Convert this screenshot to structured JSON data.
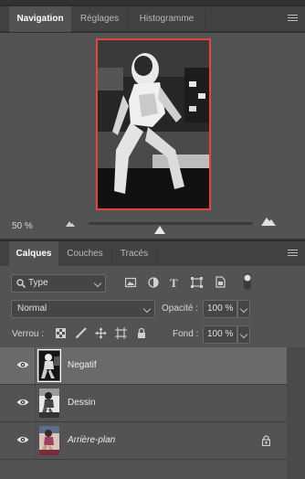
{
  "top_panel": {
    "tabs": [
      {
        "label": "Navigation",
        "active": true
      },
      {
        "label": "Réglages",
        "active": false
      },
      {
        "label": "Histogramme",
        "active": false
      }
    ],
    "menu_icon": "hamburger-menu-icon"
  },
  "navigator": {
    "zoom": "50 %",
    "zoom_slider_value_percent": 50,
    "view_rect_color": "#e34444"
  },
  "layers_panel": {
    "tabs": [
      {
        "label": "Calques",
        "active": true
      },
      {
        "label": "Couches",
        "active": false
      },
      {
        "label": "Tracés",
        "active": false
      }
    ],
    "filter": {
      "type_label": "Type",
      "icons": [
        "image-filter-icon",
        "adjustment-filter-icon",
        "type-filter-icon",
        "shape-filter-icon",
        "smart-object-filter-icon",
        "filter-toggle-icon"
      ]
    },
    "blend_mode": "Normal",
    "opacity_label": "Opacité :",
    "opacity_value": "100 %",
    "lock_label": "Verrou :",
    "lock_icons": [
      "lock-transparency-icon",
      "lock-image-icon",
      "lock-position-icon",
      "lock-artboard-icon",
      "lock-all-icon"
    ],
    "fill_label": "Fond :",
    "fill_value": "100 %",
    "layers": [
      {
        "name": "Negatif",
        "visible": true,
        "selected": true,
        "locked": false,
        "italic": false
      },
      {
        "name": "Dessin",
        "visible": true,
        "selected": false,
        "locked": false,
        "italic": false
      },
      {
        "name": "Arrière-plan",
        "visible": true,
        "selected": false,
        "locked": true,
        "italic": true
      }
    ]
  },
  "colors": {
    "panel_bg": "#535353",
    "tabbar_bg": "#424242",
    "selected_layer_bg": "#6a6a6a",
    "accent_red": "#e34444"
  }
}
